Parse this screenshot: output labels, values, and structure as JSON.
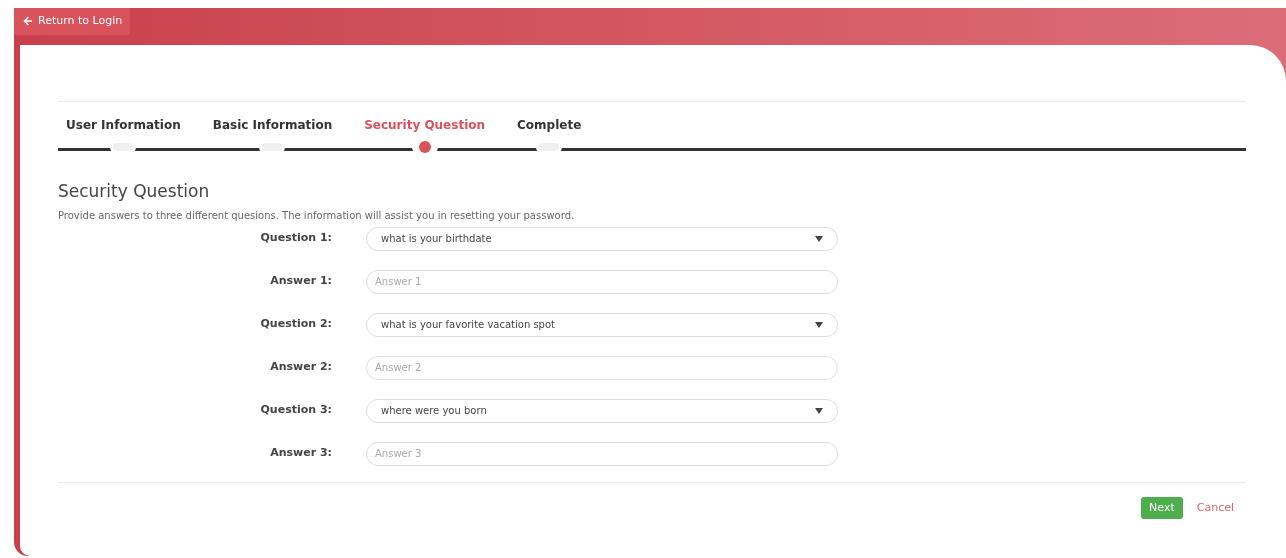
{
  "header": {
    "back_link": "Return to Login"
  },
  "steps": [
    {
      "label": "User Information",
      "selected": false
    },
    {
      "label": "Basic Information",
      "selected": false
    },
    {
      "label": "Security Question",
      "selected": true
    },
    {
      "label": "Complete",
      "selected": false
    }
  ],
  "section": {
    "title": "Security Question",
    "description": "Provide answers to three different quesions. The information will assist you in resetting your password."
  },
  "rows": [
    {
      "kind": "select",
      "label": "Question 1:",
      "value": "what is your birthdate"
    },
    {
      "kind": "input",
      "label": "Answer 1:",
      "placeholder": "Answer 1"
    },
    {
      "kind": "select",
      "label": "Question 2:",
      "value": "what is your favorite vacation spot"
    },
    {
      "kind": "input",
      "label": "Answer 2:",
      "placeholder": "Answer 2"
    },
    {
      "kind": "select",
      "label": "Question 3:",
      "value": "where were you born"
    },
    {
      "kind": "input",
      "label": "Answer 3:",
      "placeholder": "Answer 3"
    }
  ],
  "buttons": {
    "next": "Next",
    "cancel": "Cancel"
  }
}
